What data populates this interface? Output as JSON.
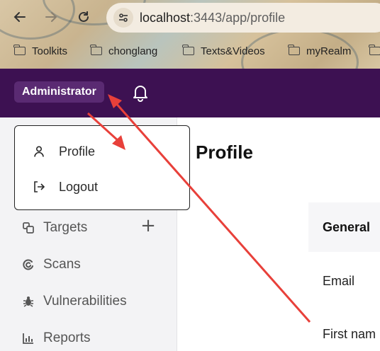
{
  "browser": {
    "url_host": "localhost",
    "url_port": ":3443",
    "url_path": "/app/profile",
    "bookmarks": [
      {
        "label": "Toolkits"
      },
      {
        "label": "chonglang"
      },
      {
        "label": "Texts&Videos"
      },
      {
        "label": "myRealm"
      }
    ]
  },
  "header": {
    "user_label": "Administrator",
    "bell_icon": "bell-icon"
  },
  "dropdown": {
    "items": [
      {
        "label": "Profile",
        "icon": "user-icon"
      },
      {
        "label": "Logout",
        "icon": "logout-icon"
      }
    ]
  },
  "sidebar": {
    "items": [
      {
        "label": "Targets",
        "icon": "targets-icon"
      },
      {
        "label": "Scans",
        "icon": "scans-icon"
      },
      {
        "label": "Vulnerabilities",
        "icon": "bug-icon"
      },
      {
        "label": "Reports",
        "icon": "reports-icon"
      }
    ]
  },
  "main": {
    "title": "Profile",
    "section": "General",
    "fields": [
      {
        "label": "Email"
      },
      {
        "label": "First nam"
      }
    ]
  },
  "colors": {
    "header_bg": "#3d1152",
    "user_chip_bg": "#5a2a72",
    "sidebar_bg": "#f3f3f5",
    "annotation": "#e8403a"
  }
}
